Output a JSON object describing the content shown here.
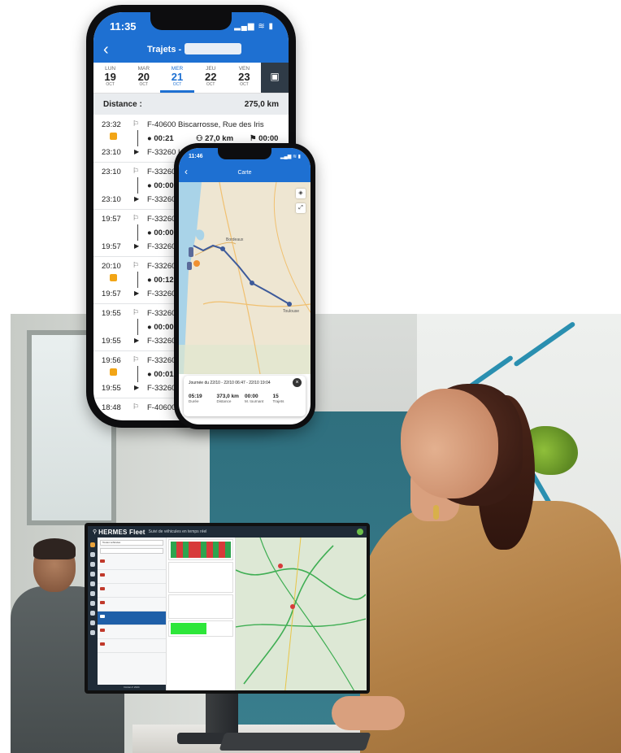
{
  "desktop": {
    "brand": "HERMES Fleet",
    "subtitle": "Suivi de véhicules en temps réel",
    "list_search": "Toutes véhicules",
    "list_footer": "Dorian-fr 2024"
  },
  "phone_trips": {
    "time": "11:35",
    "status": "▂▄▆ ≋ ▮",
    "title": "Trajets -",
    "days": [
      {
        "name": "LUN",
        "num": "19",
        "month": "OCT",
        "active": false
      },
      {
        "name": "MAR",
        "num": "20",
        "month": "OCT",
        "active": false
      },
      {
        "name": "MER",
        "num": "21",
        "month": "OCT",
        "active": true
      },
      {
        "name": "JEU",
        "num": "22",
        "month": "OCT",
        "active": false
      },
      {
        "name": "VEN",
        "num": "23",
        "month": "OCT",
        "active": false
      }
    ],
    "distance_label": "Distance :",
    "distance_value": "275,0 km",
    "trips": [
      {
        "start": "23:32",
        "end": "23:10",
        "from": "F-40600 Biscarrosse,  Rue des Iris",
        "to": "F-33260 La Teste-de-Buch, Avenue Vol",
        "duration": "00:21",
        "distance": "27,0 km",
        "stop": "00:00",
        "locked": true
      },
      {
        "start": "23:10",
        "end": "23:10",
        "from": "F-33260 La Teste",
        "to": "F-33260 La Teste",
        "duration": "00:00",
        "distance": "",
        "stop": "",
        "locked": false
      },
      {
        "start": "19:57",
        "end": "19:57",
        "from": "F-33260 La Teste",
        "to": "F-33260 La Teste",
        "duration": "00:00",
        "distance": "",
        "stop": "",
        "locked": false
      },
      {
        "start": "20:10",
        "end": "19:57",
        "from": "F-33260 La Teste",
        "to": "F-33260 La Teste",
        "duration": "00:12",
        "distance": "",
        "stop": "",
        "locked": true
      },
      {
        "start": "19:55",
        "end": "19:55",
        "from": "F-33260 La Teste",
        "to": "F-33260 La Teste",
        "duration": "00:00",
        "distance": "",
        "stop": "",
        "locked": false
      },
      {
        "start": "19:56",
        "end": "19:55",
        "from": "F-33260 La Teste",
        "to": "F-33260 La Teste",
        "duration": "00:01",
        "distance": "",
        "stop": "",
        "locked": true
      },
      {
        "start": "18:48",
        "end": "",
        "from": "F-40600 Biscarrosse",
        "to": "",
        "duration": "",
        "distance": "",
        "stop": "",
        "locked": false
      }
    ]
  },
  "phone_map": {
    "time": "11:46",
    "status": "▂▄▆ ≋ ▮",
    "title": "Carte",
    "journey": "Journée du 22/10 - 22/10 06:47 - 22/10 19:04",
    "stats": [
      {
        "value": "05:19",
        "label": "Durée"
      },
      {
        "value": "373,0 km",
        "label": "Distance"
      },
      {
        "value": "00:00",
        "label": "M. tournant"
      },
      {
        "value": "15",
        "label": "Trajets"
      }
    ],
    "cities": [
      "Bordeaux",
      "Toulouse"
    ]
  },
  "colors": {
    "app_blue": "#1e70d2",
    "dark_bar": "#1f2b37",
    "lock_orange": "#f2a516",
    "route": "#3d5a9a"
  }
}
